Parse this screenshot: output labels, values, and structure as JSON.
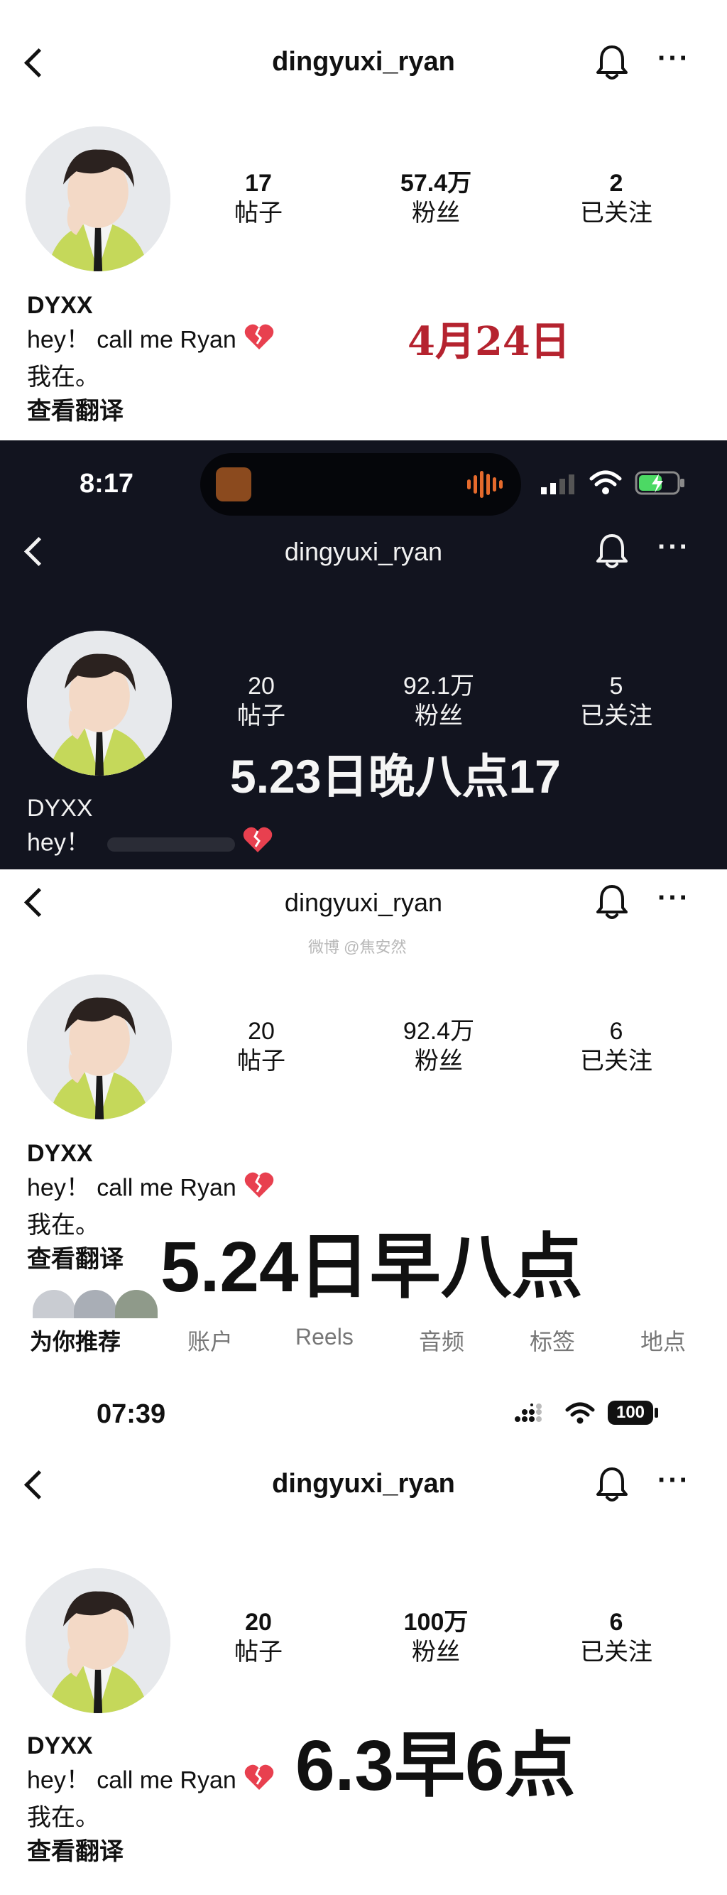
{
  "panels": [
    {
      "username": "dingyuxi_ryan",
      "stats": [
        {
          "value": "17",
          "label": "帖子"
        },
        {
          "value": "57.4万",
          "label": "粉丝"
        },
        {
          "value": "2",
          "label": "已关注"
        }
      ],
      "name": "DYXX",
      "bio_line1": "hey！  call me Ryan",
      "bio_line2": "我在。",
      "translate": "查看翻译",
      "stamp": "4月24日",
      "stamp_color": "#b5232f"
    },
    {
      "status_time": "8:17",
      "username": "dingyuxi_ryan",
      "stats": [
        {
          "value": "20",
          "label": "帖子"
        },
        {
          "value": "92.1万",
          "label": "粉丝"
        },
        {
          "value": "5",
          "label": "已关注"
        }
      ],
      "name": "DYXX",
      "bio_line1": "hey！",
      "stamp": "5.23日晚八点17"
    },
    {
      "username": "dingyuxi_ryan",
      "watermark": "微博 @焦安然",
      "stats": [
        {
          "value": "20",
          "label": "帖子"
        },
        {
          "value": "92.4万",
          "label": "粉丝"
        },
        {
          "value": "6",
          "label": "已关注"
        }
      ],
      "name": "DYXX",
      "bio_line1": "hey！  call me Ryan",
      "bio_line2": "我在。",
      "translate": "查看翻译",
      "stamp": "5.24日早八点",
      "tabs": [
        "为你推荐",
        "账户",
        "Reels",
        "音频",
        "标签",
        "地点"
      ]
    },
    {
      "status_time": "07:39",
      "battery": "100",
      "username": "dingyuxi_ryan",
      "stats": [
        {
          "value": "20",
          "label": "帖子"
        },
        {
          "value": "100万",
          "label": "粉丝"
        },
        {
          "value": "6",
          "label": "已关注"
        }
      ],
      "name": "DYXX",
      "bio_line1": "hey！  call me Ryan",
      "bio_line2": "我在。",
      "translate": "查看翻译",
      "stamp": "6.3早6点"
    }
  ],
  "icons": {
    "back": "chevron-left-icon",
    "bell": "bell-icon",
    "more": "more-horizontal-icon",
    "heart": "mending-heart-emoji"
  },
  "colors": {
    "dark_bg": "#12141f",
    "accent_red": "#b5232f",
    "battery_green": "#4cd964"
  }
}
